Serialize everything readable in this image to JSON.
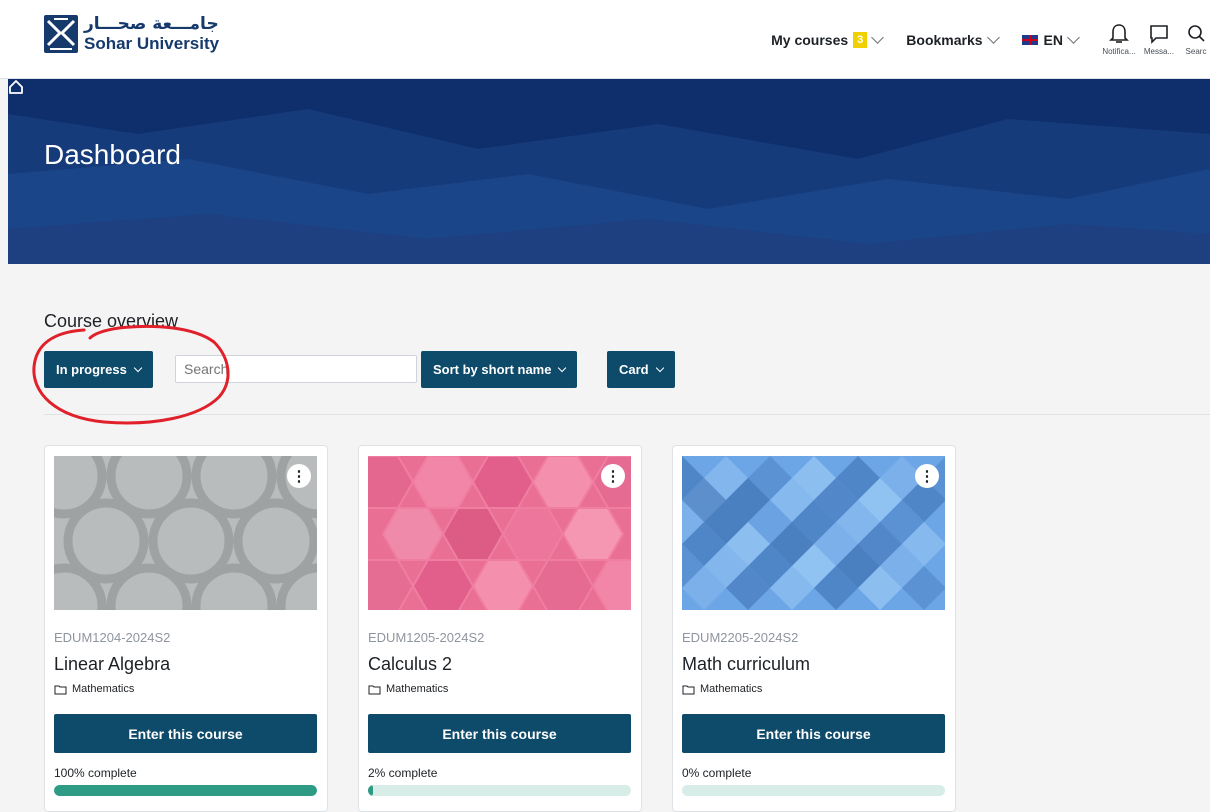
{
  "header": {
    "logo_ar": "جامـــعة صحـــار",
    "logo_en": "Sohar University",
    "my_courses_label": "My courses",
    "my_courses_count": "3",
    "bookmarks_label": "Bookmarks",
    "lang_label": "EN",
    "notifications_label": "Notifica...",
    "messages_label": "Messa...",
    "search_label": "Searc"
  },
  "banner": {
    "title": "Dashboard"
  },
  "overview": {
    "title": "Course overview",
    "filter_label": "In progress",
    "search_placeholder": "Search",
    "sort_label": "Sort by short name",
    "view_label": "Card"
  },
  "colors": {
    "primary": "#0e4a6a",
    "progress": "#2e9c85",
    "banner": "#10306e",
    "badge": "#f0d000",
    "annotation": "#e0202a"
  },
  "courses": [
    {
      "code": "EDUM1204-2024S2",
      "name": "Linear Algebra",
      "category": "Mathematics",
      "button": "Enter this course",
      "progress_text": "100% complete",
      "progress": 1.0,
      "image_pattern": "circles-grey"
    },
    {
      "code": "EDUM1205-2024S2",
      "name": "Calculus 2",
      "category": "Mathematics",
      "button": "Enter this course",
      "progress_text": "2% complete",
      "progress": 0.02,
      "image_pattern": "hexagons-pink"
    },
    {
      "code": "EDUM2205-2024S2",
      "name": "Math curriculum",
      "category": "Mathematics",
      "button": "Enter this course",
      "progress_text": "0% complete",
      "progress": 0.0,
      "image_pattern": "diamonds-blue"
    }
  ]
}
